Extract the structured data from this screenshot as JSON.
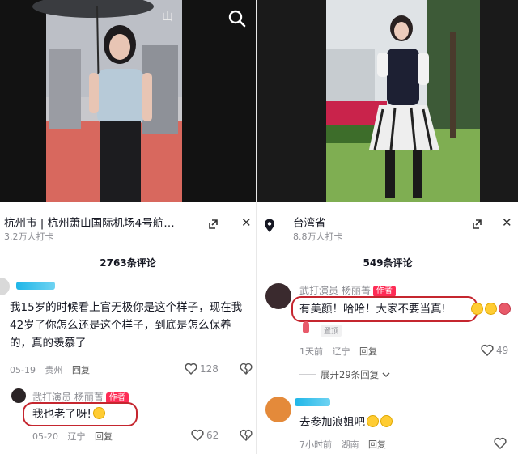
{
  "left": {
    "location": {
      "title": "杭州市 | 杭州萧山国际机场4号航…",
      "checkins": "3.2万人打卡"
    },
    "comment_count": "2763条评论",
    "comment1": {
      "text": "我15岁的时候看上官无极你是这个样子，现在我42岁了你怎么还是这个样子，到底是怎么保养的，真的羡慕了",
      "date": "05-19",
      "region": "贵州",
      "reply": "回复",
      "likes": "128"
    },
    "reply1": {
      "author": "武打演员 杨丽菁",
      "author_tag": "作者",
      "text": "我也老了呀!",
      "date": "05-20",
      "region": "辽宁",
      "reply": "回复",
      "likes": "62"
    }
  },
  "right": {
    "location": {
      "title": "台湾省",
      "checkins": "8.8万人打卡"
    },
    "comment_count": "549条评论",
    "comment1": {
      "author": "武打演员 杨丽菁",
      "author_tag": "作者",
      "text": "有美颜！哈哈！大家不要当真!",
      "pinned": "置顶",
      "date": "1天前",
      "region": "辽宁",
      "reply": "回复",
      "likes": "49",
      "expand": "展开29条回复"
    },
    "comment2": {
      "text": "去参加浪姐吧",
      "date": "7小时前",
      "region": "湖南",
      "reply": "回复"
    }
  },
  "colors": {
    "accent": "#fe2c55",
    "highlight_box": "#c5262f",
    "muted": "#8a8b91"
  },
  "icons": [
    "search-icon",
    "location-pin-icon",
    "expand-icon",
    "close-icon",
    "heart-icon",
    "dislike-icon",
    "chevron-down-icon"
  ]
}
